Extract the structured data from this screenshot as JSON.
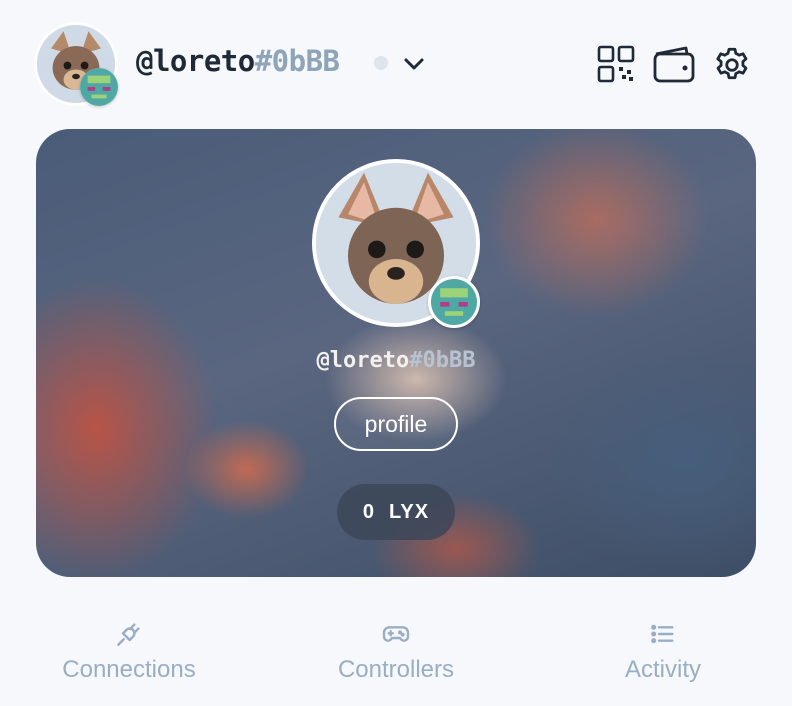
{
  "header": {
    "username": "@loreto",
    "tag": "#0bBB",
    "icons": [
      "qr-code-icon",
      "wallet-icon",
      "gear-icon",
      "chevron-down-icon"
    ],
    "status_color": "#dde4ec"
  },
  "card": {
    "username": "@loreto",
    "tag": "#0bBB",
    "profile_label": "profile",
    "balance_amount": "0",
    "balance_currency": "LYX"
  },
  "tabs": [
    {
      "label": "Connections",
      "icon": "plug-icon"
    },
    {
      "label": "Controllers",
      "icon": "gamepad-icon"
    },
    {
      "label": "Activity",
      "icon": "list-icon"
    }
  ],
  "colors": {
    "text_dark": "#1f2937",
    "tag_gray": "#8ea4b8",
    "tab_gray": "#9aaec3",
    "background": "#f6f8fb"
  }
}
